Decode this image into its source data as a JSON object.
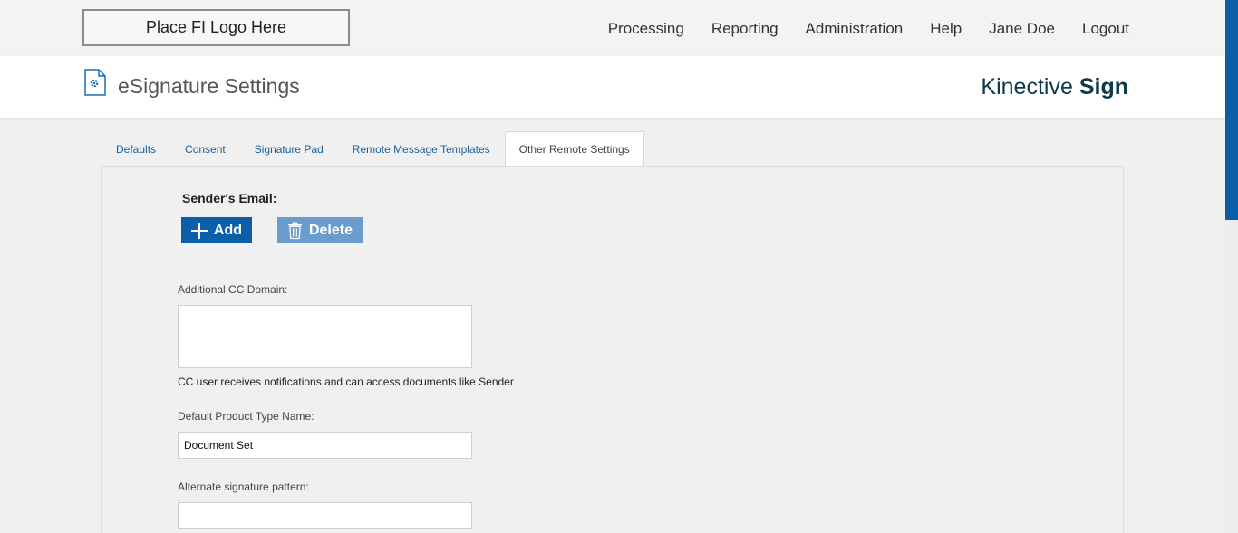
{
  "topbar": {
    "logo_text": "Place FI Logo Here",
    "nav": [
      "Processing",
      "Reporting",
      "Administration",
      "Help",
      "Jane Doe",
      "Logout"
    ]
  },
  "header": {
    "title": "eSignature Settings",
    "brand_light": "Kinective",
    "brand_bold": "Sign",
    "icon": "settings-document-icon"
  },
  "tabs": [
    {
      "label": "Defaults",
      "active": false
    },
    {
      "label": "Consent",
      "active": false
    },
    {
      "label": "Signature Pad",
      "active": false
    },
    {
      "label": "Remote Message Templates",
      "active": false
    },
    {
      "label": "Other Remote Settings",
      "active": true
    }
  ],
  "form": {
    "senders_email_label": "Sender's Email:",
    "add_label": "Add",
    "delete_label": "Delete",
    "cc_domain_label": "Additional CC Domain:",
    "cc_domain_value": "",
    "cc_help": "CC user receives notifications and can access documents like Sender",
    "product_type_label": "Default Product Type Name:",
    "product_type_value": "Document Set",
    "alt_sig_label": "Alternate signature pattern:",
    "alt_sig_value": ""
  },
  "colors": {
    "primary": "#0b5fa8",
    "primary_disabled": "#6a9ccc",
    "tab_link": "#1a5f9a",
    "brand": "#0c3a4a"
  }
}
